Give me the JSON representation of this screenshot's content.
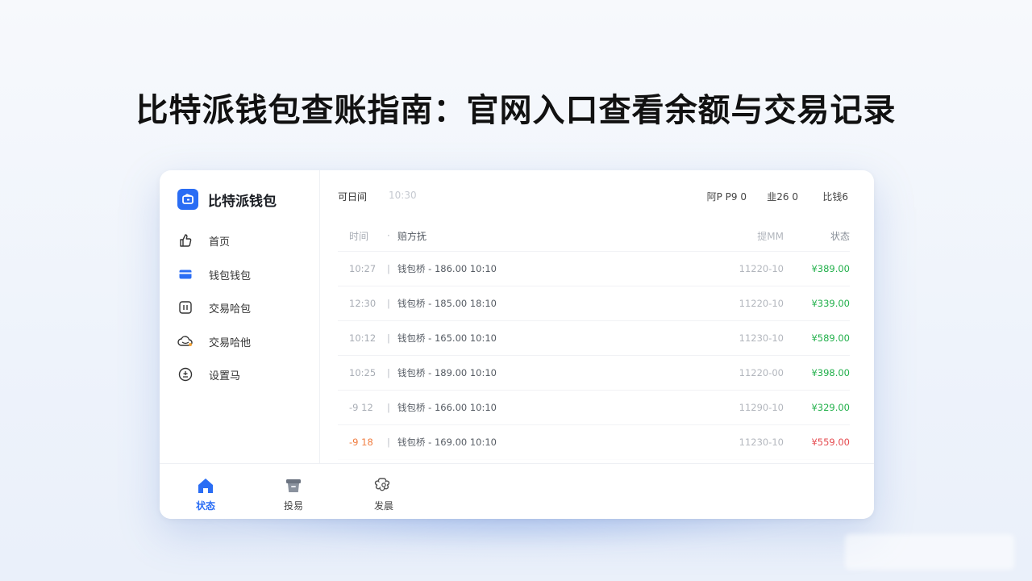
{
  "page": {
    "headline": "比特派钱包查账指南：官网入口查看余额与交易记录"
  },
  "app": {
    "name": "比特派钱包",
    "accent": "#2a6df4",
    "income_color": "#22b04b",
    "expense_color": "#e5484d",
    "pending_time_color": "#f07a3c"
  },
  "sidebar": {
    "items": [
      {
        "label": "首页",
        "icon": "thumb-icon"
      },
      {
        "label": "钱包钱包",
        "icon": "wallet-card-icon"
      },
      {
        "label": "交易哈包",
        "icon": "transaction-icon"
      },
      {
        "label": "交易哈他",
        "icon": "cloud-icon"
      },
      {
        "label": "设置马",
        "icon": "settings-icon"
      }
    ]
  },
  "topbar": {
    "left_label": "可日间",
    "left_value": "10:30",
    "right_items": [
      "阿P P9 0",
      "韭26 0",
      "比钱6"
    ]
  },
  "table": {
    "headers": {
      "time": "时间",
      "desc": "赔方抚",
      "date": "提MM",
      "status": "状态"
    },
    "rows": [
      {
        "time": "10:27",
        "desc": "钱包桥 - 186.00 10:10",
        "date": "11220-10",
        "amount": "¥389.00",
        "type": "in"
      },
      {
        "time": "12:30",
        "desc": "钱包桥 - 185.00 18:10",
        "date": "11220-10",
        "amount": "¥339.00",
        "type": "in"
      },
      {
        "time": "10:12",
        "desc": "钱包桥 - 165.00 10:10",
        "date": "11230-10",
        "amount": "¥589.00",
        "type": "in"
      },
      {
        "time": "10:25",
        "desc": "钱包桥 - 189.00 10:10",
        "date": "11220-00",
        "amount": "¥398.00",
        "type": "in"
      },
      {
        "time": "-9 12",
        "desc": "钱包桥 - 166.00 10:10",
        "date": "11290-10",
        "amount": "¥329.00",
        "type": "in"
      },
      {
        "time": "-9 18",
        "desc": "钱包桥 - 169.00 10:10",
        "date": "11230-10",
        "amount": "¥559.00",
        "type": "out"
      }
    ]
  },
  "bottom_tabs": [
    {
      "label": "状态",
      "icon": "home-icon",
      "active": true
    },
    {
      "label": "投易",
      "icon": "box-icon",
      "active": false
    },
    {
      "label": "发晨",
      "icon": "gear-flower-icon",
      "active": false
    }
  ]
}
